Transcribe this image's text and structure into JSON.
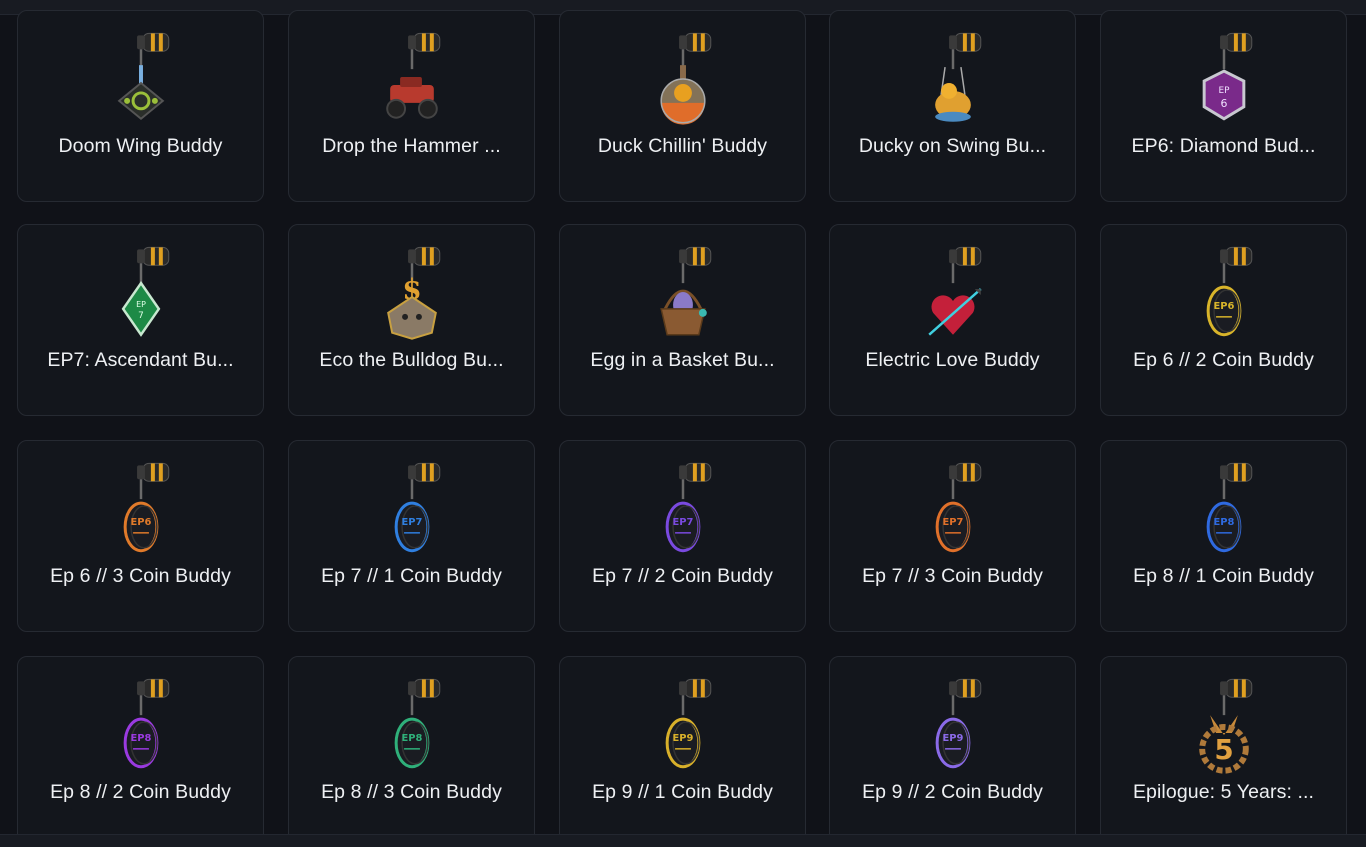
{
  "buddies": [
    {
      "name": "Doom Wing Buddy",
      "icon": "doom-wing-charm-icon",
      "color": "#9bbf3a"
    },
    {
      "name": "Drop the Hammer ...",
      "icon": "monster-truck-charm-icon",
      "color": "#b83a2e"
    },
    {
      "name": "Duck Chillin' Buddy",
      "icon": "duck-orb-charm-icon",
      "color": "#e06d2a"
    },
    {
      "name": "Ducky on Swing Bu...",
      "icon": "duck-swing-charm-icon",
      "color": "#e0a030"
    },
    {
      "name": "EP6: Diamond Bud...",
      "icon": "ep6-hex-charm-icon",
      "color": "#9a3ea8"
    },
    {
      "name": "EP7: Ascendant Bu...",
      "icon": "ep7-diamond-charm-icon",
      "color": "#2fae5c"
    },
    {
      "name": "Eco the Bulldog Bu...",
      "icon": "bulldog-charm-icon",
      "color": "#8a7a66"
    },
    {
      "name": "Egg in a Basket Bu...",
      "icon": "egg-basket-charm-icon",
      "color": "#8a5a32"
    },
    {
      "name": "Electric Love Buddy",
      "icon": "heart-arrow-charm-icon",
      "color": "#c4203a"
    },
    {
      "name": "Ep 6 // 2 Coin Buddy",
      "icon": "coin-charm-icon",
      "color": "#d8b42a"
    },
    {
      "name": "Ep 6 // 3 Coin Buddy",
      "icon": "coin-charm-icon",
      "color": "#e07a2a"
    },
    {
      "name": "Ep 7 // 1 Coin Buddy",
      "icon": "coin-charm-icon",
      "color": "#2f7fe0"
    },
    {
      "name": "Ep 7 // 2 Coin Buddy",
      "icon": "coin-charm-icon",
      "color": "#7a4ae0"
    },
    {
      "name": "Ep 7 // 3 Coin Buddy",
      "icon": "coin-charm-icon",
      "color": "#e0702a"
    },
    {
      "name": "Ep 8 // 1 Coin Buddy",
      "icon": "coin-charm-icon",
      "color": "#2f6ae0"
    },
    {
      "name": "Ep 8 // 2 Coin Buddy",
      "icon": "coin-charm-icon",
      "color": "#9a3ae0"
    },
    {
      "name": "Ep 8 // 3 Coin Buddy",
      "icon": "coin-charm-icon",
      "color": "#2fb07a"
    },
    {
      "name": "Ep 9 // 1 Coin Buddy",
      "icon": "coin-charm-icon",
      "color": "#d8b02a"
    },
    {
      "name": "Ep 9 // 2 Coin Buddy",
      "icon": "coin-charm-icon",
      "color": "#8a6ae8"
    },
    {
      "name": "Epilogue: 5 Years: ...",
      "icon": "five-years-charm-icon",
      "color": "#c88a3a"
    }
  ],
  "coin_texts": {
    "9": "EP6",
    "10": "EP6",
    "11": "EP7",
    "12": "EP7",
    "13": "EP7",
    "14": "EP8",
    "15": "EP8",
    "16": "EP8",
    "17": "EP9",
    "18": "EP9"
  }
}
